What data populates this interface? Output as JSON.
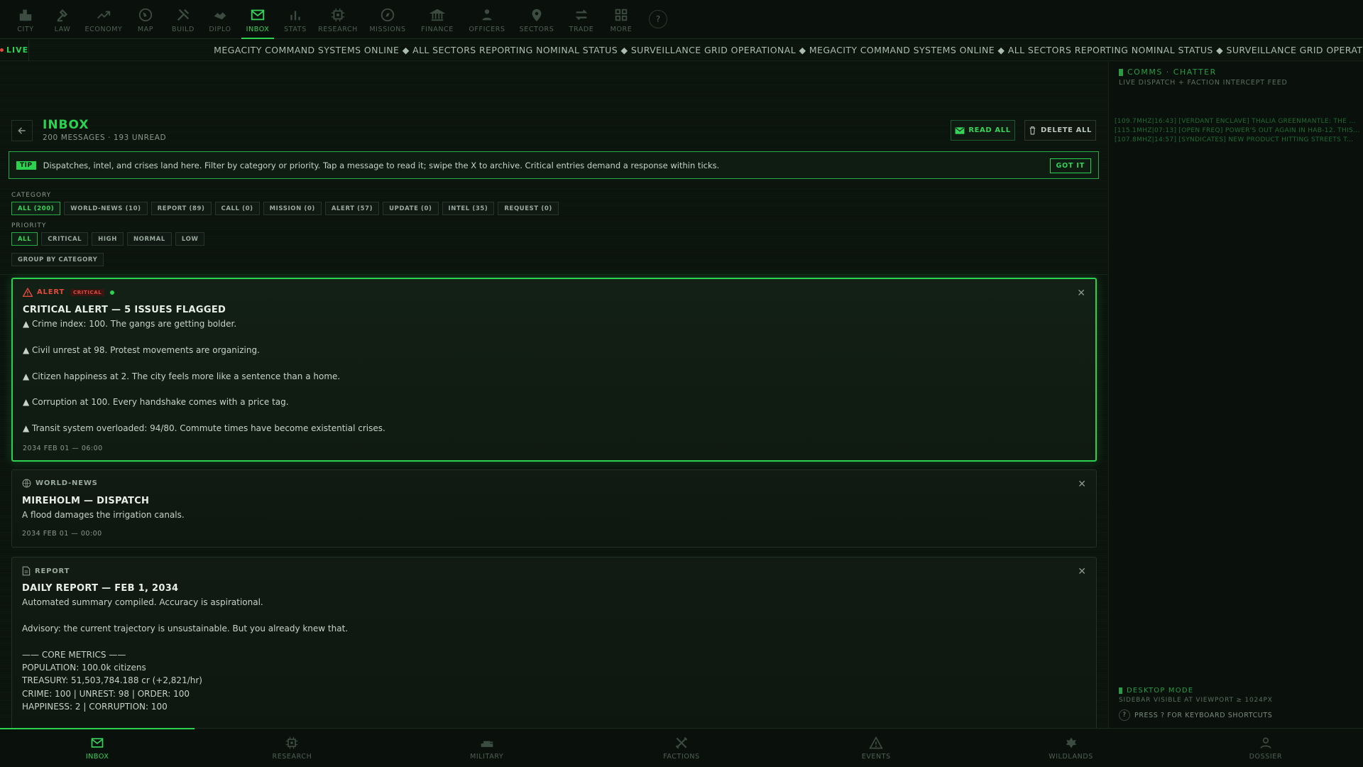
{
  "topnav": {
    "items": [
      {
        "label": "CITY",
        "icon": "city-icon"
      },
      {
        "label": "LAW",
        "icon": "gavel-icon"
      },
      {
        "label": "ECONOMY",
        "icon": "trend-icon"
      },
      {
        "label": "MAP",
        "icon": "globe-icon"
      },
      {
        "label": "BUILD",
        "icon": "tools-icon"
      },
      {
        "label": "DIPLO",
        "icon": "handshake-icon"
      },
      {
        "label": "INBOX",
        "icon": "mail-icon",
        "active": true
      },
      {
        "label": "STATS",
        "icon": "bar-chart-icon"
      },
      {
        "label": "RESEARCH",
        "icon": "chip-icon"
      },
      {
        "label": "MISSIONS",
        "icon": "compass-icon"
      },
      {
        "label": "FINANCE",
        "icon": "bank-icon"
      },
      {
        "label": "OFFICERS",
        "icon": "officers-icon"
      },
      {
        "label": "SECTORS",
        "icon": "pin-icon"
      },
      {
        "label": "TRADE",
        "icon": "swap-icon"
      },
      {
        "label": "MORE",
        "icon": "grid-icon"
      }
    ],
    "help": "?"
  },
  "ticker": {
    "live": "LIVE",
    "text": "MEGACITY COMMAND SYSTEMS ONLINE ◆ ALL SECTORS REPORTING NOMINAL STATUS ◆ SURVEILLANCE GRID OPERATIONAL ◆ MEGACITY COMMAND SYSTEMS ONLINE ◆ ALL SECTORS REPORTING NOMINAL STATUS ◆ SURVEILLANCE GRID OPERATIONAL ◆"
  },
  "inbox": {
    "title": "INBOX",
    "subtitle": "200 MESSAGES · 193 UNREAD",
    "read_all": "READ ALL",
    "delete_all": "DELETE ALL"
  },
  "tip": {
    "tag": "TIP",
    "text": "Dispatches, intel, and crises land here. Filter by category or priority. Tap a message to read it; swipe the X to archive. Critical entries demand a response within ticks.",
    "button": "GOT IT"
  },
  "filters": {
    "category_label": "CATEGORY",
    "categories": [
      "ALL (200)",
      "WORLD-NEWS (10)",
      "REPORT (89)",
      "CALL (0)",
      "MISSION (0)",
      "ALERT (57)",
      "UPDATE (0)",
      "INTEL (35)",
      "REQUEST (0)"
    ],
    "priority_label": "PRIORITY",
    "priorities": [
      "ALL",
      "CRITICAL",
      "HIGH",
      "NORMAL",
      "LOW"
    ],
    "group_by": "GROUP BY CATEGORY"
  },
  "messages": [
    {
      "category": "ALERT",
      "badge": "CRITICAL",
      "title": "CRITICAL ALERT — 5 ISSUES FLAGGED",
      "lines": [
        "▲ Crime index: 100. The gangs are getting bolder.",
        "",
        "▲ Civil unrest at 98. Protest movements are organizing.",
        "",
        "▲ Citizen happiness at 2. The city feels more like a sentence than a home.",
        "",
        "▲ Corruption at 100. Every handshake comes with a price tag.",
        "",
        "▲ Transit system overloaded: 94/80. Commute times have become existential crises."
      ],
      "time": "2034 FEB 01 — 06:00"
    },
    {
      "category": "WORLD-NEWS",
      "title": "MIREHOLM — DISPATCH",
      "lines": [
        "A flood damages the irrigation canals."
      ],
      "time": "2034 FEB 01 — 00:00"
    },
    {
      "category": "REPORT",
      "title": "DAILY REPORT — FEB 1, 2034",
      "lines": [
        "Automated summary compiled. Accuracy is aspirational.",
        "",
        "Advisory: the current trajectory is unsustainable. But you already knew that.",
        "",
        "—— CORE METRICS ——",
        "POPULATION: 100.0k citizens",
        "TREASURY: 51,503,784.188 cr (+2,821/hr)",
        "CRIME: 100 | UNREST: 98 | ORDER: 100",
        "HAPPINESS: 2 | CORRUPTION: 100"
      ]
    }
  ],
  "sidebar": {
    "title": "COMMS · CHATTER",
    "subtitle": "LIVE DISPATCH + FACTION INTERCEPT FEED",
    "feed": [
      "[109.7MHZ|16:43] [VERDANT ENCLAVE] THALIA GREENMANTLE: THE ...",
      "[115.1MHZ|07:13] [OPEN FREQ] POWER'S OUT AGAIN IN HAB-12. THIS...",
      "[107.8MHZ|14:57] [SYNDICATES] NEW PRODUCT HITTING STREETS T..."
    ],
    "desktop_title": "DESKTOP MODE",
    "desktop_sub": "SIDEBAR VISIBLE AT VIEWPORT ≥ 1024PX",
    "shortcut_key": "?",
    "shortcut_text": "PRESS ? FOR KEYBOARD SHORTCUTS"
  },
  "bottomnav": {
    "items": [
      {
        "label": "INBOX",
        "icon": "mail-icon",
        "active": true
      },
      {
        "label": "RESEARCH",
        "icon": "chip-icon"
      },
      {
        "label": "MILITARY",
        "icon": "tank-icon"
      },
      {
        "label": "FACTIONS",
        "icon": "swords-icon"
      },
      {
        "label": "EVENTS",
        "icon": "warning-icon"
      },
      {
        "label": "WILDLANDS",
        "icon": "leaf-icon"
      },
      {
        "label": "DOSSIER",
        "icon": "person-icon"
      }
    ]
  },
  "colors": {
    "accent": "#2bd250",
    "danger": "#e14a3d",
    "background": "#0b130d"
  }
}
